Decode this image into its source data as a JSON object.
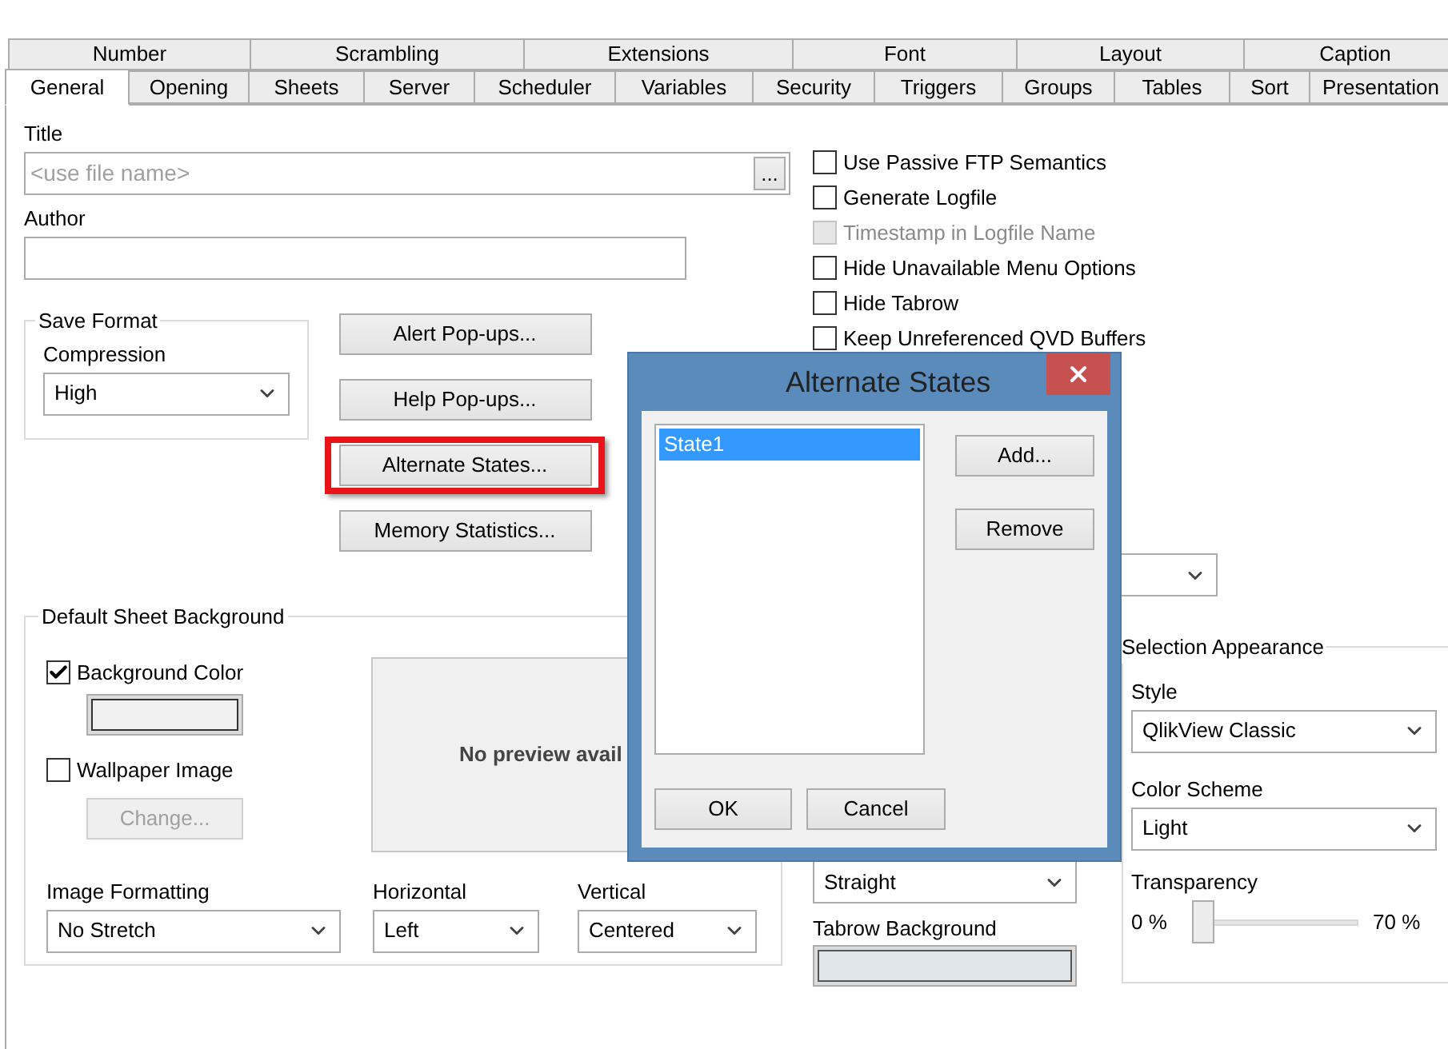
{
  "tabs_upper": [
    {
      "label": "Number",
      "selected": false
    },
    {
      "label": "Scrambling",
      "selected": false
    },
    {
      "label": "Extensions",
      "selected": false
    },
    {
      "label": "Font",
      "selected": false
    },
    {
      "label": "Layout",
      "selected": false
    },
    {
      "label": "Caption",
      "selected": false
    }
  ],
  "tabs_lower": [
    {
      "label": "General",
      "selected": true
    },
    {
      "label": "Opening",
      "selected": false
    },
    {
      "label": "Sheets",
      "selected": false
    },
    {
      "label": "Server",
      "selected": false
    },
    {
      "label": "Scheduler",
      "selected": false
    },
    {
      "label": "Variables",
      "selected": false
    },
    {
      "label": "Security",
      "selected": false
    },
    {
      "label": "Triggers",
      "selected": false
    },
    {
      "label": "Groups",
      "selected": false
    },
    {
      "label": "Tables",
      "selected": false
    },
    {
      "label": "Sort",
      "selected": false
    },
    {
      "label": "Presentation",
      "selected": false
    }
  ],
  "title": {
    "label": "Title",
    "placeholder": "<use file name>",
    "browse_button": "..."
  },
  "author": {
    "label": "Author"
  },
  "save_format": {
    "legend": "Save Format",
    "compression_label": "Compression",
    "compression_value": "High"
  },
  "buttons": [
    {
      "label": "Alert Pop-ups...",
      "highlighted": false
    },
    {
      "label": "Help Pop-ups...",
      "highlighted": false
    },
    {
      "label": "Alternate States...",
      "highlighted": true
    },
    {
      "label": "Memory Statistics...",
      "highlighted": false
    }
  ],
  "options": [
    {
      "label": "Use Passive FTP Semantics",
      "checked": false,
      "disabled": false
    },
    {
      "label": "Generate Logfile",
      "checked": false,
      "disabled": false
    },
    {
      "label": "Timestamp in Logfile Name",
      "checked": false,
      "disabled": true
    },
    {
      "label": "Hide Unavailable Menu Options",
      "checked": false,
      "disabled": false
    },
    {
      "label": "Hide Tabrow",
      "checked": false,
      "disabled": false
    },
    {
      "label": "Keep Unreferenced QVD Buffers",
      "checked": false,
      "disabled": false
    }
  ],
  "default_sheet_background": {
    "legend": "Default Sheet Background",
    "background_color": {
      "label": "Background Color",
      "checked": true,
      "color": "#f0f0f0"
    },
    "wallpaper_image": {
      "label": "Wallpaper Image",
      "checked": false
    },
    "change_button": {
      "label": "Change...",
      "disabled": true
    },
    "preview_text": "No preview avail",
    "selects": [
      {
        "label": "Image Formatting",
        "value": "No Stretch"
      },
      {
        "label": "Horizontal",
        "value": "Left"
      },
      {
        "label": "Vertical",
        "value": "Centered"
      }
    ]
  },
  "tab_style": {
    "value": "Straight"
  },
  "tabrow_background": {
    "label": "Tabrow Background",
    "color": "#dfe5e8"
  },
  "selection_appearance": {
    "legend": "Selection Appearance",
    "style_label": "Style",
    "style_value": "QlikView Classic",
    "scheme_label": "Color Scheme",
    "scheme_value": "Light",
    "transparency_label": "Transparency",
    "min_label": "0 %",
    "max_label": "70 %",
    "level": 0
  },
  "dialog": {
    "title": "Alternate States",
    "states": [
      {
        "label": "State1",
        "selected": true
      }
    ],
    "side_buttons": [
      "Add...",
      "Remove"
    ],
    "ok": "OK",
    "cancel": "Cancel"
  }
}
